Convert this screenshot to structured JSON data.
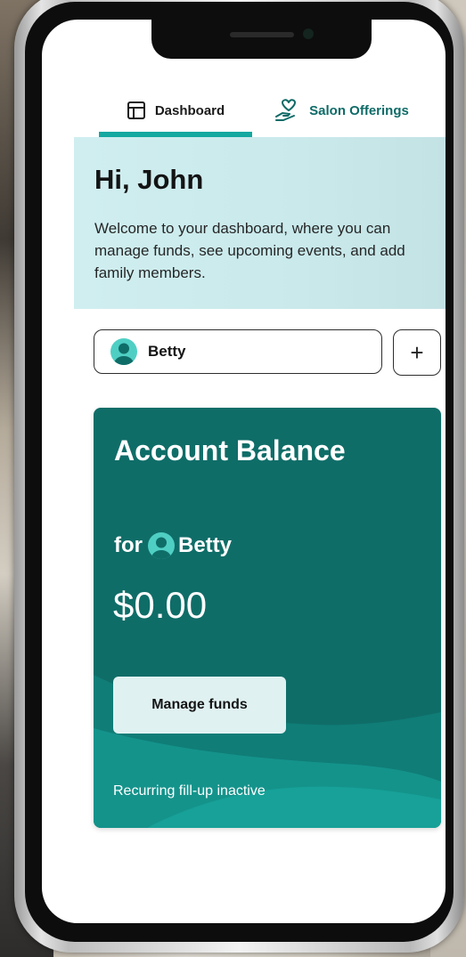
{
  "tabs": [
    {
      "label": "Dashboard",
      "icon": "dashboard-icon",
      "active": true
    },
    {
      "label": "Salon Offerings",
      "icon": "hand-heart-icon",
      "active": false
    }
  ],
  "welcome": {
    "greeting": "Hi, John",
    "message": "Welcome to your dashboard, where you can manage funds, see upcoming events, and add family members."
  },
  "member_selector": {
    "selected": "Betty",
    "add_label": "+"
  },
  "account_card": {
    "title": "Account Balance",
    "for_label": "for",
    "member_name": "Betty",
    "balance": "$0.00",
    "manage_button": "Manage funds",
    "recurring_status": "Recurring fill-up inactive"
  },
  "colors": {
    "accent": "#13a8a0",
    "card": "#0f6d68",
    "welcome_bg": "#cdeced",
    "button_bg": "#e0f1f1"
  }
}
